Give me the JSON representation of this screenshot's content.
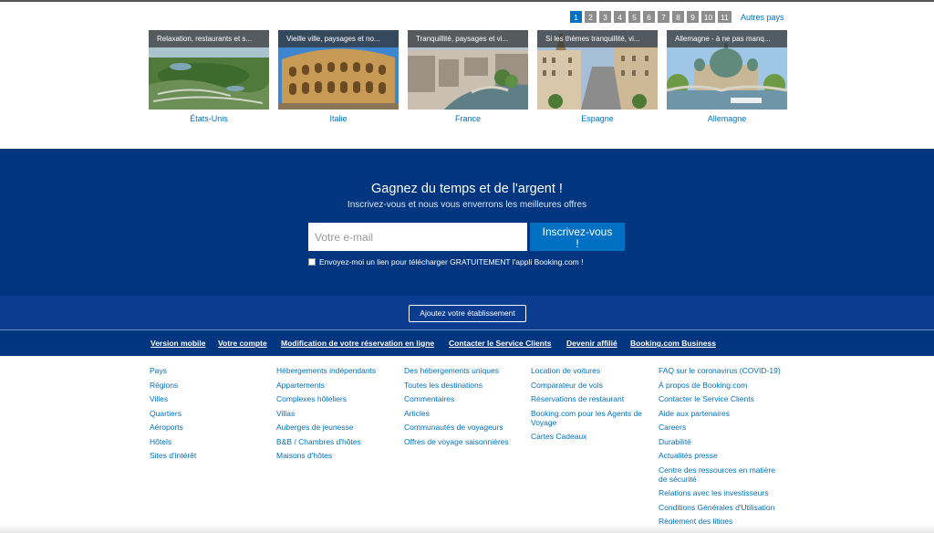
{
  "pagination": {
    "pages": [
      "1",
      "2",
      "3",
      "4",
      "5",
      "6",
      "7",
      "8",
      "9",
      "10",
      "11"
    ],
    "active": "1",
    "other_countries": "Autres pays"
  },
  "destinations": [
    {
      "caption": "Relaxation, restaurants et s...",
      "name": "États-Unis"
    },
    {
      "caption": "Vieille ville, paysages et no...",
      "name": "Italie"
    },
    {
      "caption": "Tranquillité, paysages et vi...",
      "name": "France"
    },
    {
      "caption": "Si les thèmes tranquillité, vi...",
      "name": "Espagne"
    },
    {
      "caption": "Allemagne - à ne pas manq...",
      "name": "Allemagne"
    }
  ],
  "newsletter": {
    "title": "Gagnez du temps et de l'argent !",
    "subtitle": "Inscrivez-vous et nous vous enverrons les meilleures offres",
    "email_placeholder": "Votre e-mail",
    "button_line1": "Inscrivez-vous",
    "button_line2": "!",
    "checkbox_label": "Envoyez-moi un lien pour télécharger GRATUITEMENT l'appli Booking.com !"
  },
  "add_property": "Ajoutez votre établissement",
  "top_links": [
    "Version mobile",
    "Votre compte",
    "Modification de votre réservation en ligne",
    "Contacter le Service Clients",
    "Devenir affilié",
    "Booking.com Business"
  ],
  "footer": {
    "col1": [
      "Pays",
      "Régions",
      "Villes",
      "Quartiers",
      "Aéroports",
      "Hôtels",
      "Sites d'intérêt"
    ],
    "col2": [
      "Hébergements indépendants",
      "Appartements",
      "Complexes hôteliers",
      "Villas",
      "Auberges de jeunesse",
      "B&B / Chambres d'hôtes",
      "Maisons d'hôtes"
    ],
    "col3": [
      "Des hébergements uniques",
      "Toutes les destinations",
      "Commentaires",
      "Articles",
      "Communautés de voyageurs",
      "Offres de voyage saisonnières"
    ],
    "col4": [
      "Location de voitures",
      "Comparateur de vols",
      "Réservations de restaurant",
      "Booking.com pour les Agents de Voyage",
      "Cartes Cadeaux"
    ],
    "col5": [
      "FAQ sur le coronavirus (COVID-19)",
      "À propos de Booking.com",
      "Contacter le Service Clients",
      "Aide aux partenaires",
      "Careers",
      "Durabilité",
      "Actualités presse",
      "Centre des ressources en matière de sécurité",
      "Relations avec les investisseurs",
      "Conditions Générales d'Utilisation",
      "Règlement des litiges"
    ]
  },
  "colors": {
    "brand_dark": "#003580",
    "link": "#0071c2",
    "accent": "#0071c2"
  }
}
